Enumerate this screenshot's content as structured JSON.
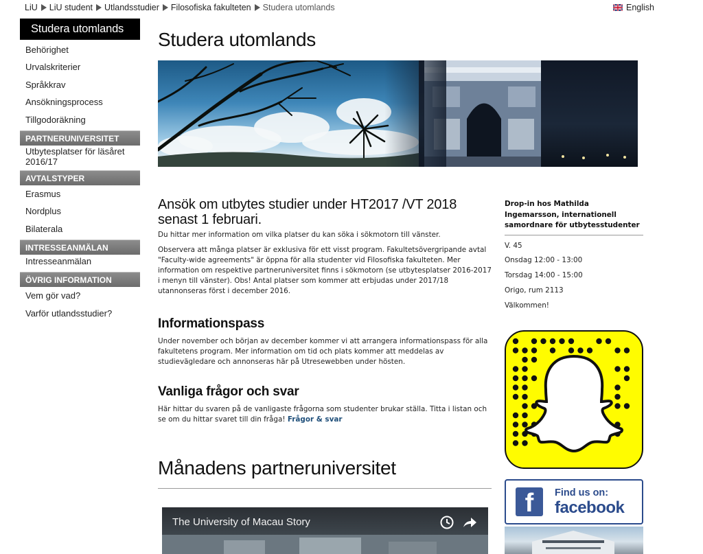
{
  "breadcrumb": {
    "items": [
      "LiU",
      "LiU student",
      "Utlandsstudier",
      "Filosofiska fakulteten",
      "Studera utomlands"
    ]
  },
  "language": {
    "label": "English",
    "icon": "uk-flag-icon"
  },
  "sidebar": {
    "title": "Studera utomlands",
    "items_top": [
      "Behörighet",
      "Urvalskriterier",
      "Språkkrav",
      "Ansökningsprocess",
      "Tillgodoräkning"
    ],
    "sections": [
      {
        "heading": "PARTNERUNIVERSITET",
        "items": [
          "Utbytesplatser för läsåret 2016/17"
        ]
      },
      {
        "heading": "AVTALSTYPER",
        "items": [
          "Erasmus",
          "Nordplus",
          "Bilaterala"
        ]
      },
      {
        "heading": "INTRESSEANMÄLAN",
        "items": [
          "Intresseanmälan"
        ]
      },
      {
        "heading": "ÖVRIG INFORMATION",
        "items": [
          "Vem gör vad?",
          "Varför utlandsstudier?"
        ]
      }
    ]
  },
  "main": {
    "title": "Studera utomlands",
    "apply": {
      "heading": "Ansök om utbytes studier under HT2017 /VT 2018 senast 1 februari.",
      "p1": "Du hittar mer information om vilka platser du kan söka i sökmotorn till vänster.",
      "p2": "Observera att många platser är exklusiva för ett visst program. Fakultetsövergripande avtal \"Faculty-wide agreements\" är öppna för alla studenter vid Filosofiska fakulteten. Mer information om respektive partneruniversitet finns i sökmotorn (se utbytesplatser 2016-2017 i menyn till vänster). Obs! Antal platser som kommer att erbjudas under 2017/18 utannonseras först i december 2016."
    },
    "info": {
      "heading": "Informationspass",
      "p": "Under november och början av december kommer vi att arrangera informationspass för alla fakultetens program. Mer information om tid och plats kommer att meddelas av studievägledare och annonseras här på Utresewebben under hösten."
    },
    "faq": {
      "heading": "Vanliga frågor och svar",
      "p": "Här hittar du svaren på de vanligaste frågorna som studenter brukar ställa. Titta i listan och se om du hittar svaret till din fråga!",
      "link": "Frågor & svar"
    },
    "partner": {
      "heading": "Månadens partneruniversitet",
      "video_title": "The University of Macau Story"
    }
  },
  "right": {
    "dropin_title": "Drop-in hos Mathilda Ingemarsson, internationell samordnare för utbytesstudenter",
    "lines": [
      "V. 45",
      "Onsdag 12:00  - 13:00",
      "Torsdag 14:00 - 15:00",
      "Origo, rum 2113",
      "Välkommen!"
    ],
    "facebook": {
      "find": "Find us on:",
      "name": "facebook",
      "logo_letter": "f"
    }
  },
  "colors": {
    "accent": "#1f4f7a",
    "facebook": "#3b5998",
    "snapchat": "#fffc00"
  }
}
